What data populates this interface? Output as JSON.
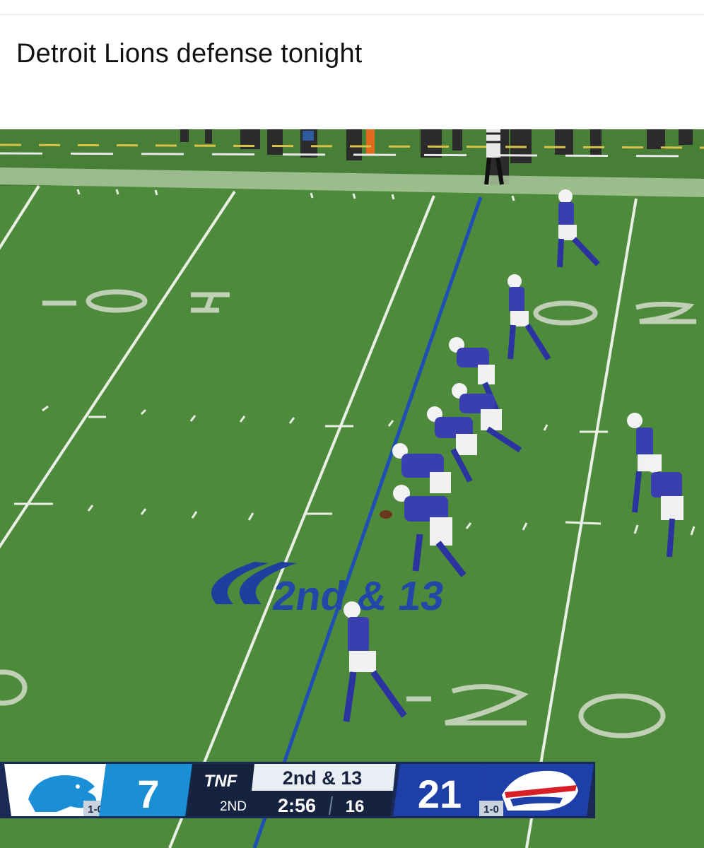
{
  "post": {
    "caption": "Detroit Lions defense tonight"
  },
  "field": {
    "yard_numbers": [
      "10",
      "20",
      "20"
    ],
    "down_marker_text": "2nd & 13",
    "line_of_scrimmage_color": "#1f4fb5",
    "turf_color": "#4f8c3c",
    "bills_jersey_color": "#3a3fb0"
  },
  "scorebug": {
    "home_team": {
      "name": "Detroit Lions",
      "logo": "lion-logo-icon",
      "score": "7",
      "record": "1-0",
      "color": "#1a8fd6"
    },
    "away_team": {
      "name": "Buffalo Bills",
      "logo": "bison-logo-icon",
      "score": "21",
      "record": "1-0",
      "color": "#1f3fa8"
    },
    "network": "TNF",
    "quarter": "2ND",
    "down_distance": "2nd & 13",
    "clock": "2:56",
    "play_clock": "16"
  }
}
